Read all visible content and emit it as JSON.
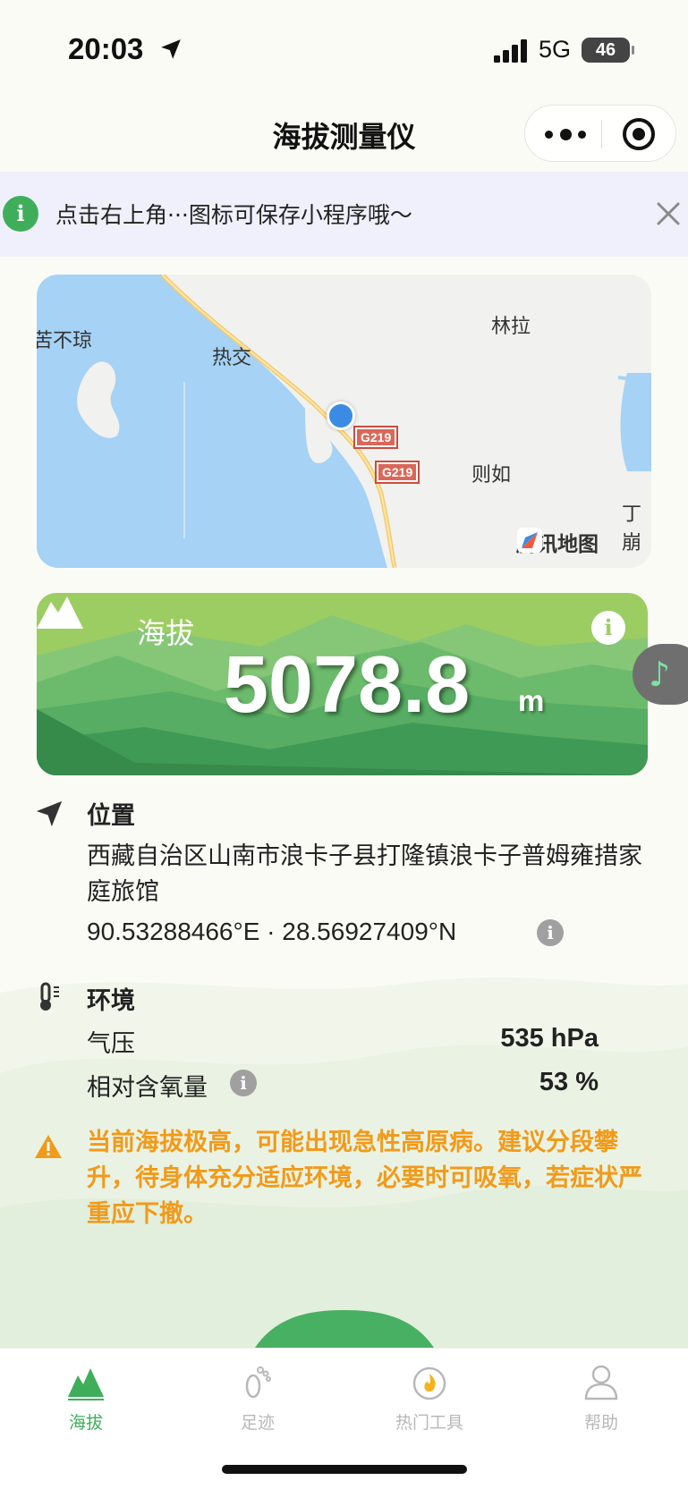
{
  "status_bar": {
    "time": "20:03",
    "network": "5G",
    "battery": "46"
  },
  "nav": {
    "title": "海拔测量仪"
  },
  "tip": {
    "text": "点击右上角···图标可保存小程序哦～"
  },
  "map": {
    "labels": [
      "林拉",
      "热交",
      "则如",
      "丁崩",
      "苦不琼"
    ],
    "road_badges": [
      "G219",
      "G219"
    ],
    "brand": "腾讯地图"
  },
  "altitude": {
    "label": "海拔",
    "value": "5078.8",
    "unit": "m"
  },
  "location": {
    "title": "位置",
    "address": "西藏自治区山南市浪卡子县打隆镇浪卡子普姆雍措家庭旅馆",
    "coords": "90.53288466°E · 28.56927409°N"
  },
  "environment": {
    "title": "环境",
    "pressure_label": "气压",
    "pressure_value": "535 hPa",
    "oxygen_label": "相对含氧量",
    "oxygen_value": "53 %"
  },
  "warning": {
    "text": "当前海拔极高，可能出现急性高原病。建议分段攀升，待身体充分适应环境，必要时可吸氧，若症状严重应下撤。"
  },
  "tabs": [
    {
      "label": "海拔",
      "icon": "mountain-icon",
      "active": true
    },
    {
      "label": "足迹",
      "icon": "footprint-icon",
      "active": false
    },
    {
      "label": "热门工具",
      "icon": "fire-icon",
      "active": false
    },
    {
      "label": "帮助",
      "icon": "user-icon",
      "active": false
    }
  ],
  "colors": {
    "accent": "#3fae5b",
    "warning": "#f29a1a",
    "card_top": "#9ccd62"
  }
}
